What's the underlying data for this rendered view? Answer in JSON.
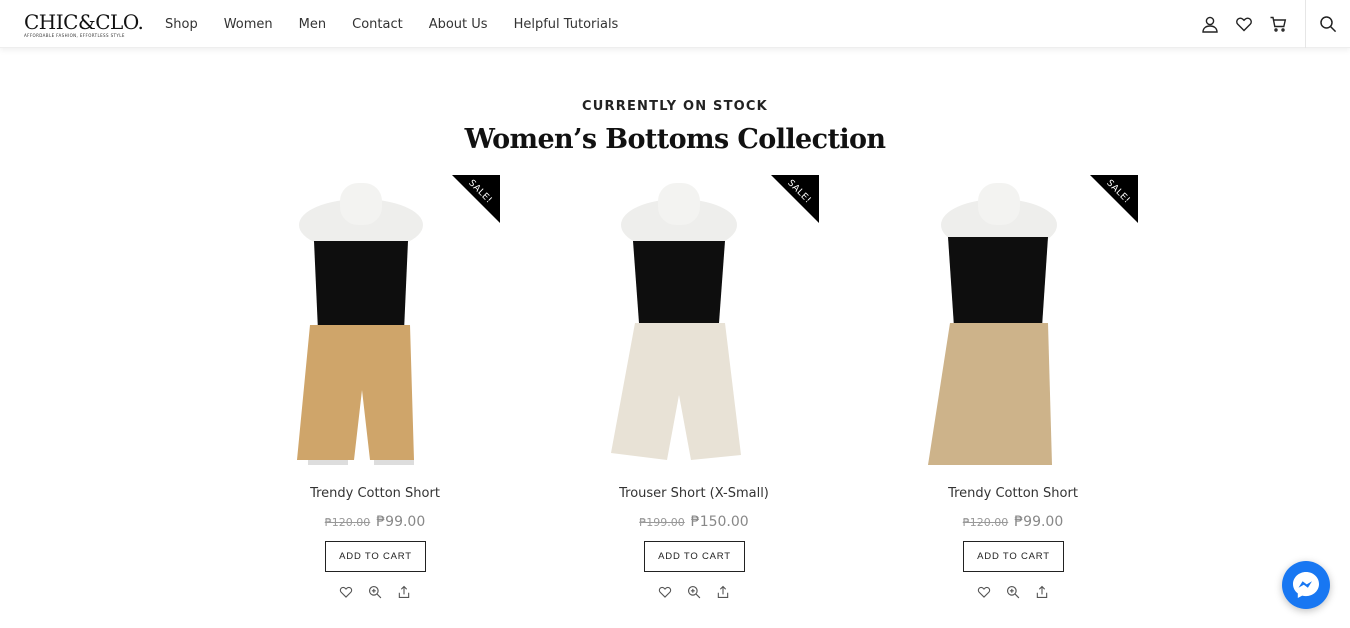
{
  "brand": {
    "name": "CHIC&CLO.",
    "tagline": "AFFORDABLE FASHION, EFFORTLESS STYLE"
  },
  "nav": [
    "Shop",
    "Women",
    "Men",
    "Contact",
    "About Us",
    "Helpful Tutorials"
  ],
  "header_icons": [
    "user-icon",
    "heart-icon",
    "cart-icon",
    "search-icon"
  ],
  "section": {
    "eyebrow": "CURRENTLY ON STOCK",
    "title": "Women’s Bottoms Collection"
  },
  "products": [
    {
      "name": "Trendy Cotton Short",
      "old_price": "₱120.00",
      "price": "₱99.00",
      "badge": "SALE!",
      "cart_label": "ADD TO CART",
      "shorts_color": "#cfa56a"
    },
    {
      "name": "Trouser Short (X-Small)",
      "old_price": "₱199.00",
      "price": "₱150.00",
      "badge": "SALE!",
      "cart_label": "ADD TO CART",
      "shorts_color": "#e8e2d6"
    },
    {
      "name": "Trendy Cotton Short",
      "old_price": "₱120.00",
      "price": "₱99.00",
      "badge": "SALE!",
      "cart_label": "ADD TO CART",
      "shorts_color": "#cdb38a"
    }
  ],
  "product_actions": [
    "heart-icon",
    "zoom-icon",
    "share-icon"
  ],
  "chat": {
    "icon": "messenger-icon",
    "color": "#1877f2"
  }
}
